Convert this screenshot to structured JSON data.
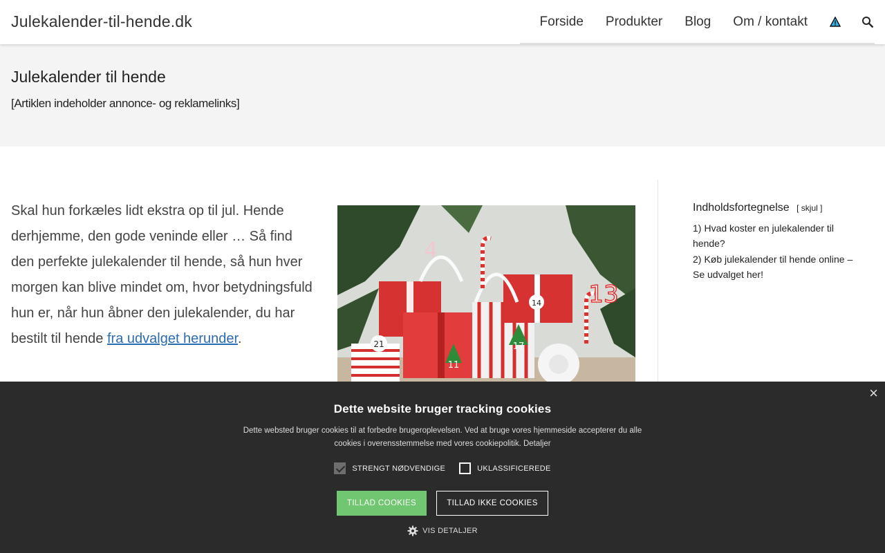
{
  "header": {
    "site_title": "Julekalender-til-hende.dk",
    "nav": [
      "Forside",
      "Produkter",
      "Blog",
      "Om / kontakt"
    ]
  },
  "page": {
    "title": "Julekalender til hende",
    "disclaimer": "[Artiklen indeholder annonce- og reklamelinks]"
  },
  "intro": {
    "text": "Skal hun forkæles lidt ekstra op til jul. Hende derhjemme, den gode veninde eller … Så find den perfekte julekalender til hende, så hun hver morgen kan blive mindet om, hvor betydningsfuld hun er, når hun åbner den julekalender, du har bestilt til hende ",
    "link_text": "fra udvalget herunder",
    "suffix": "."
  },
  "toc": {
    "title": "Indholdsfortegnelse",
    "toggle": "[ skjul ]",
    "items": [
      {
        "num": "1)",
        "label": "Hvad koster en julekalender til hende?"
      },
      {
        "num": "2)",
        "label": "Køb julekalender til hende online – Se udvalget her!"
      }
    ]
  },
  "cookie": {
    "title": "Dette website bruger tracking cookies",
    "text": "Dette websted bruger cookies til at forbedre brugeroplevelsen. Ved at bruge vores hjemmeside accepterer du alle cookies i overensstemmelse med vores cookiepolitik. Detaljer",
    "checks": [
      {
        "label": "STRENGT NØDVENDIGE",
        "checked": true
      },
      {
        "label": "UKLASSIFICEREDE",
        "checked": false
      }
    ],
    "allow_label": "TILLAD COOKIES",
    "deny_label": "TILLAD IKKE COOKIES",
    "details_label": "VIS DETALJER",
    "close_label": "×"
  },
  "colors": {
    "accent_link": "#2b6cb0",
    "banner_bg": "#2b2b2b",
    "allow_green": "#71c671"
  }
}
